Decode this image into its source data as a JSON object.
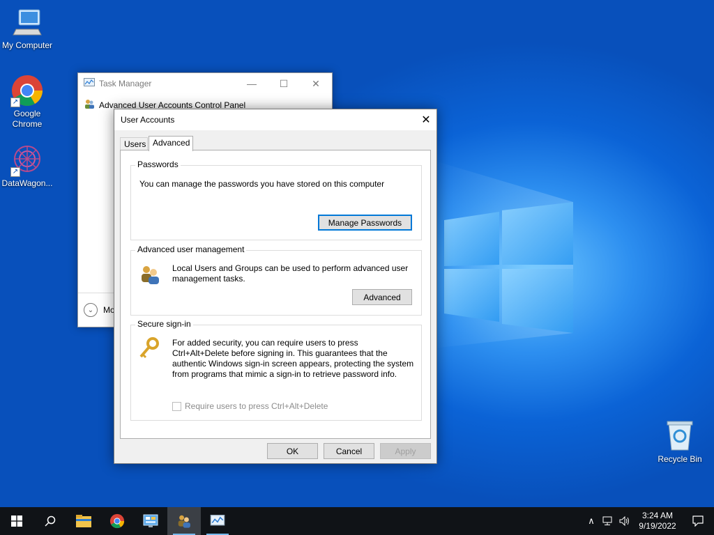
{
  "desktop": {
    "icons": [
      {
        "label": "My Computer"
      },
      {
        "label": "Google Chrome"
      },
      {
        "label": "DataWagon..."
      },
      {
        "label": "Recycle Bin"
      }
    ]
  },
  "task_manager": {
    "title": "Task Manager",
    "process_item": "Advanced User Accounts Control Panel",
    "more_details_label": "Mo",
    "caption_buttons": [
      "minimize-icon",
      "maximize-icon",
      "close-icon"
    ]
  },
  "user_accounts": {
    "title": "User Accounts",
    "tabs": [
      {
        "label": "Users",
        "active": false
      },
      {
        "label": "Advanced",
        "active": true
      }
    ],
    "passwords": {
      "legend": "Passwords",
      "text": "You can manage the passwords you have stored on this computer",
      "button": "Manage Passwords"
    },
    "advanced_user_management": {
      "legend": "Advanced user management",
      "text": "Local Users and Groups can be used to perform advanced user management tasks.",
      "button": "Advanced"
    },
    "secure_signin": {
      "legend": "Secure sign-in",
      "text": "For added security, you can require users to press Ctrl+Alt+Delete before signing in. This guarantees that the authentic Windows sign-in screen appears, protecting the system from programs that mimic a sign-in to retrieve password info.",
      "checkbox_label": "Require users to press Ctrl+Alt+Delete",
      "checkbox_checked": false,
      "checkbox_enabled": false
    },
    "buttons": {
      "ok": "OK",
      "cancel": "Cancel",
      "apply": "Apply"
    }
  },
  "taskbar": {
    "items": [
      "start-icon",
      "search-icon",
      "file-explorer-icon",
      "chrome-icon",
      "control-panel-icon",
      "user-accounts-icon",
      "task-manager-icon"
    ],
    "clock": {
      "time": "3:24 AM",
      "date": "9/19/2022"
    }
  },
  "colors": {
    "accent": "#0078d7",
    "taskbar": "#101317",
    "desktop": "#0a5cc9"
  }
}
